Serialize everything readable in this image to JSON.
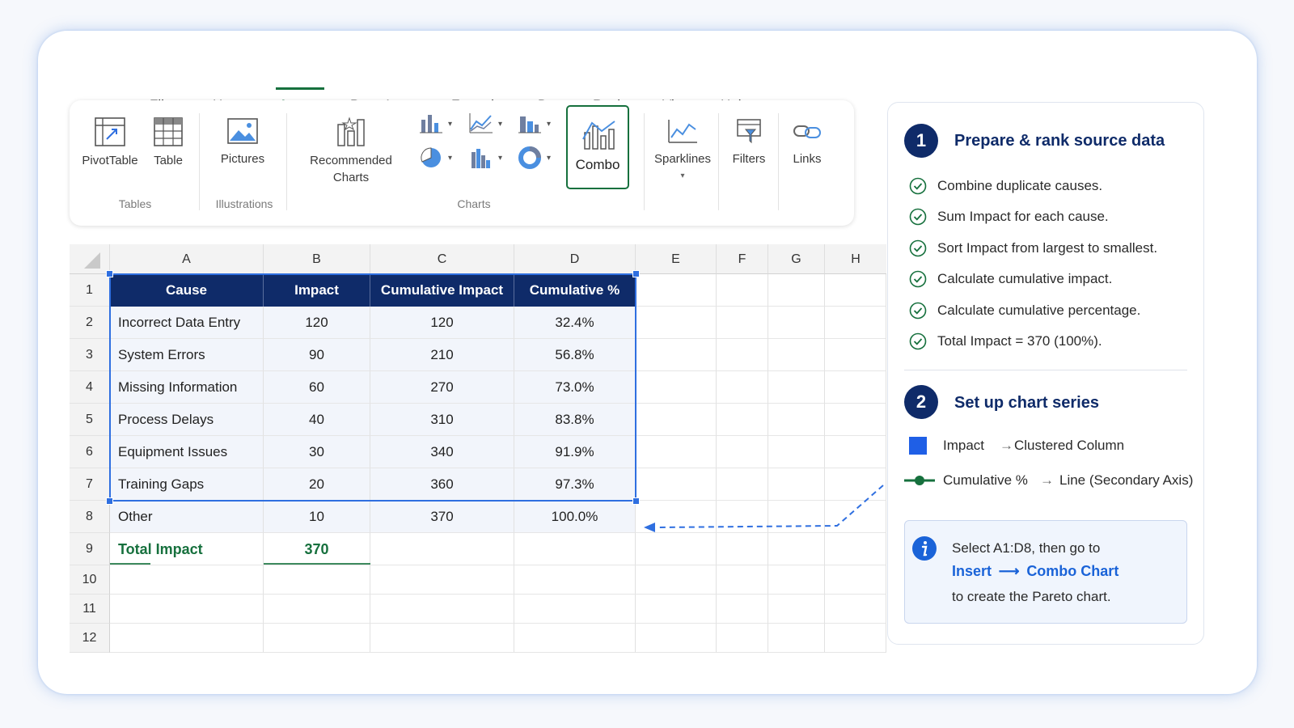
{
  "tabs": [
    {
      "label": "File"
    },
    {
      "label": "Home"
    },
    {
      "label": "Insert"
    },
    {
      "label": "Page Layout"
    },
    {
      "label": "Formulas"
    },
    {
      "label": "Data"
    },
    {
      "label": "Review"
    },
    {
      "label": "View"
    },
    {
      "label": "Help"
    }
  ],
  "active_tab": "Insert",
  "ribbon": {
    "pivottable": "PivotTable",
    "table": "Table",
    "tables_group": "Tables",
    "pictures": "Pictures",
    "illustrations_group": "Illustrations",
    "recommended_line1": "Recommended",
    "recommended_line2": "Charts",
    "charts_group": "Charts",
    "combo": "Combo",
    "sparklines": "Sparklines",
    "filters": "Filters",
    "links": "Links"
  },
  "sheet": {
    "columns": [
      "A",
      "B",
      "C",
      "D",
      "E",
      "F",
      "G",
      "H"
    ],
    "rows": [
      "1",
      "2",
      "3",
      "4",
      "5",
      "6",
      "7",
      "8",
      "9",
      "10",
      "11",
      "12"
    ],
    "headers": [
      "Cause",
      "Impact",
      "Cumulative Impact",
      "Cumulative %"
    ],
    "data": [
      [
        "Incorrect Data Entry",
        "120",
        "120",
        "32.4%"
      ],
      [
        "System Errors",
        "90",
        "210",
        "56.8%"
      ],
      [
        "Missing Information",
        "60",
        "270",
        "73.0%"
      ],
      [
        "Process Delays",
        "40",
        "310",
        "83.8%"
      ],
      [
        "Equipment Issues",
        "30",
        "340",
        "91.9%"
      ],
      [
        "Training Gaps",
        "20",
        "360",
        "97.3%"
      ],
      [
        "Other",
        "10",
        "370",
        "100.0%"
      ]
    ],
    "total_label": "Total Impact",
    "total_value": "370"
  },
  "panel": {
    "step1_num": "1",
    "step1_title": "Prepare & rank source data",
    "step1_items": [
      "Combine duplicate causes.",
      "Sum Impact for each cause.",
      "Sort Impact from largest to smallest.",
      "Calculate cumulative impact.",
      "Calculate cumulative percentage.",
      "Total Impact = 370 (100%)."
    ],
    "step2_num": "2",
    "step2_title": "Set up chart series",
    "series": [
      {
        "name": "Impact",
        "arrow": "→",
        "type": "Clustered Column"
      },
      {
        "name": "Cumulative %",
        "arrow": "→",
        "type": "Line (Secondary Axis)"
      }
    ],
    "info": {
      "line1": "Select A1:D8, then go to",
      "link1": "Insert",
      "arrow": "⟶",
      "link2": "Combo Chart",
      "line3": "to create the Pareto chart."
    }
  },
  "colors": {
    "accent_green": "#16703d",
    "header_navy": "#0f2b69",
    "selection_blue": "#2f6fe0",
    "series_column": "#1f5fe6",
    "series_line": "#16703d"
  }
}
